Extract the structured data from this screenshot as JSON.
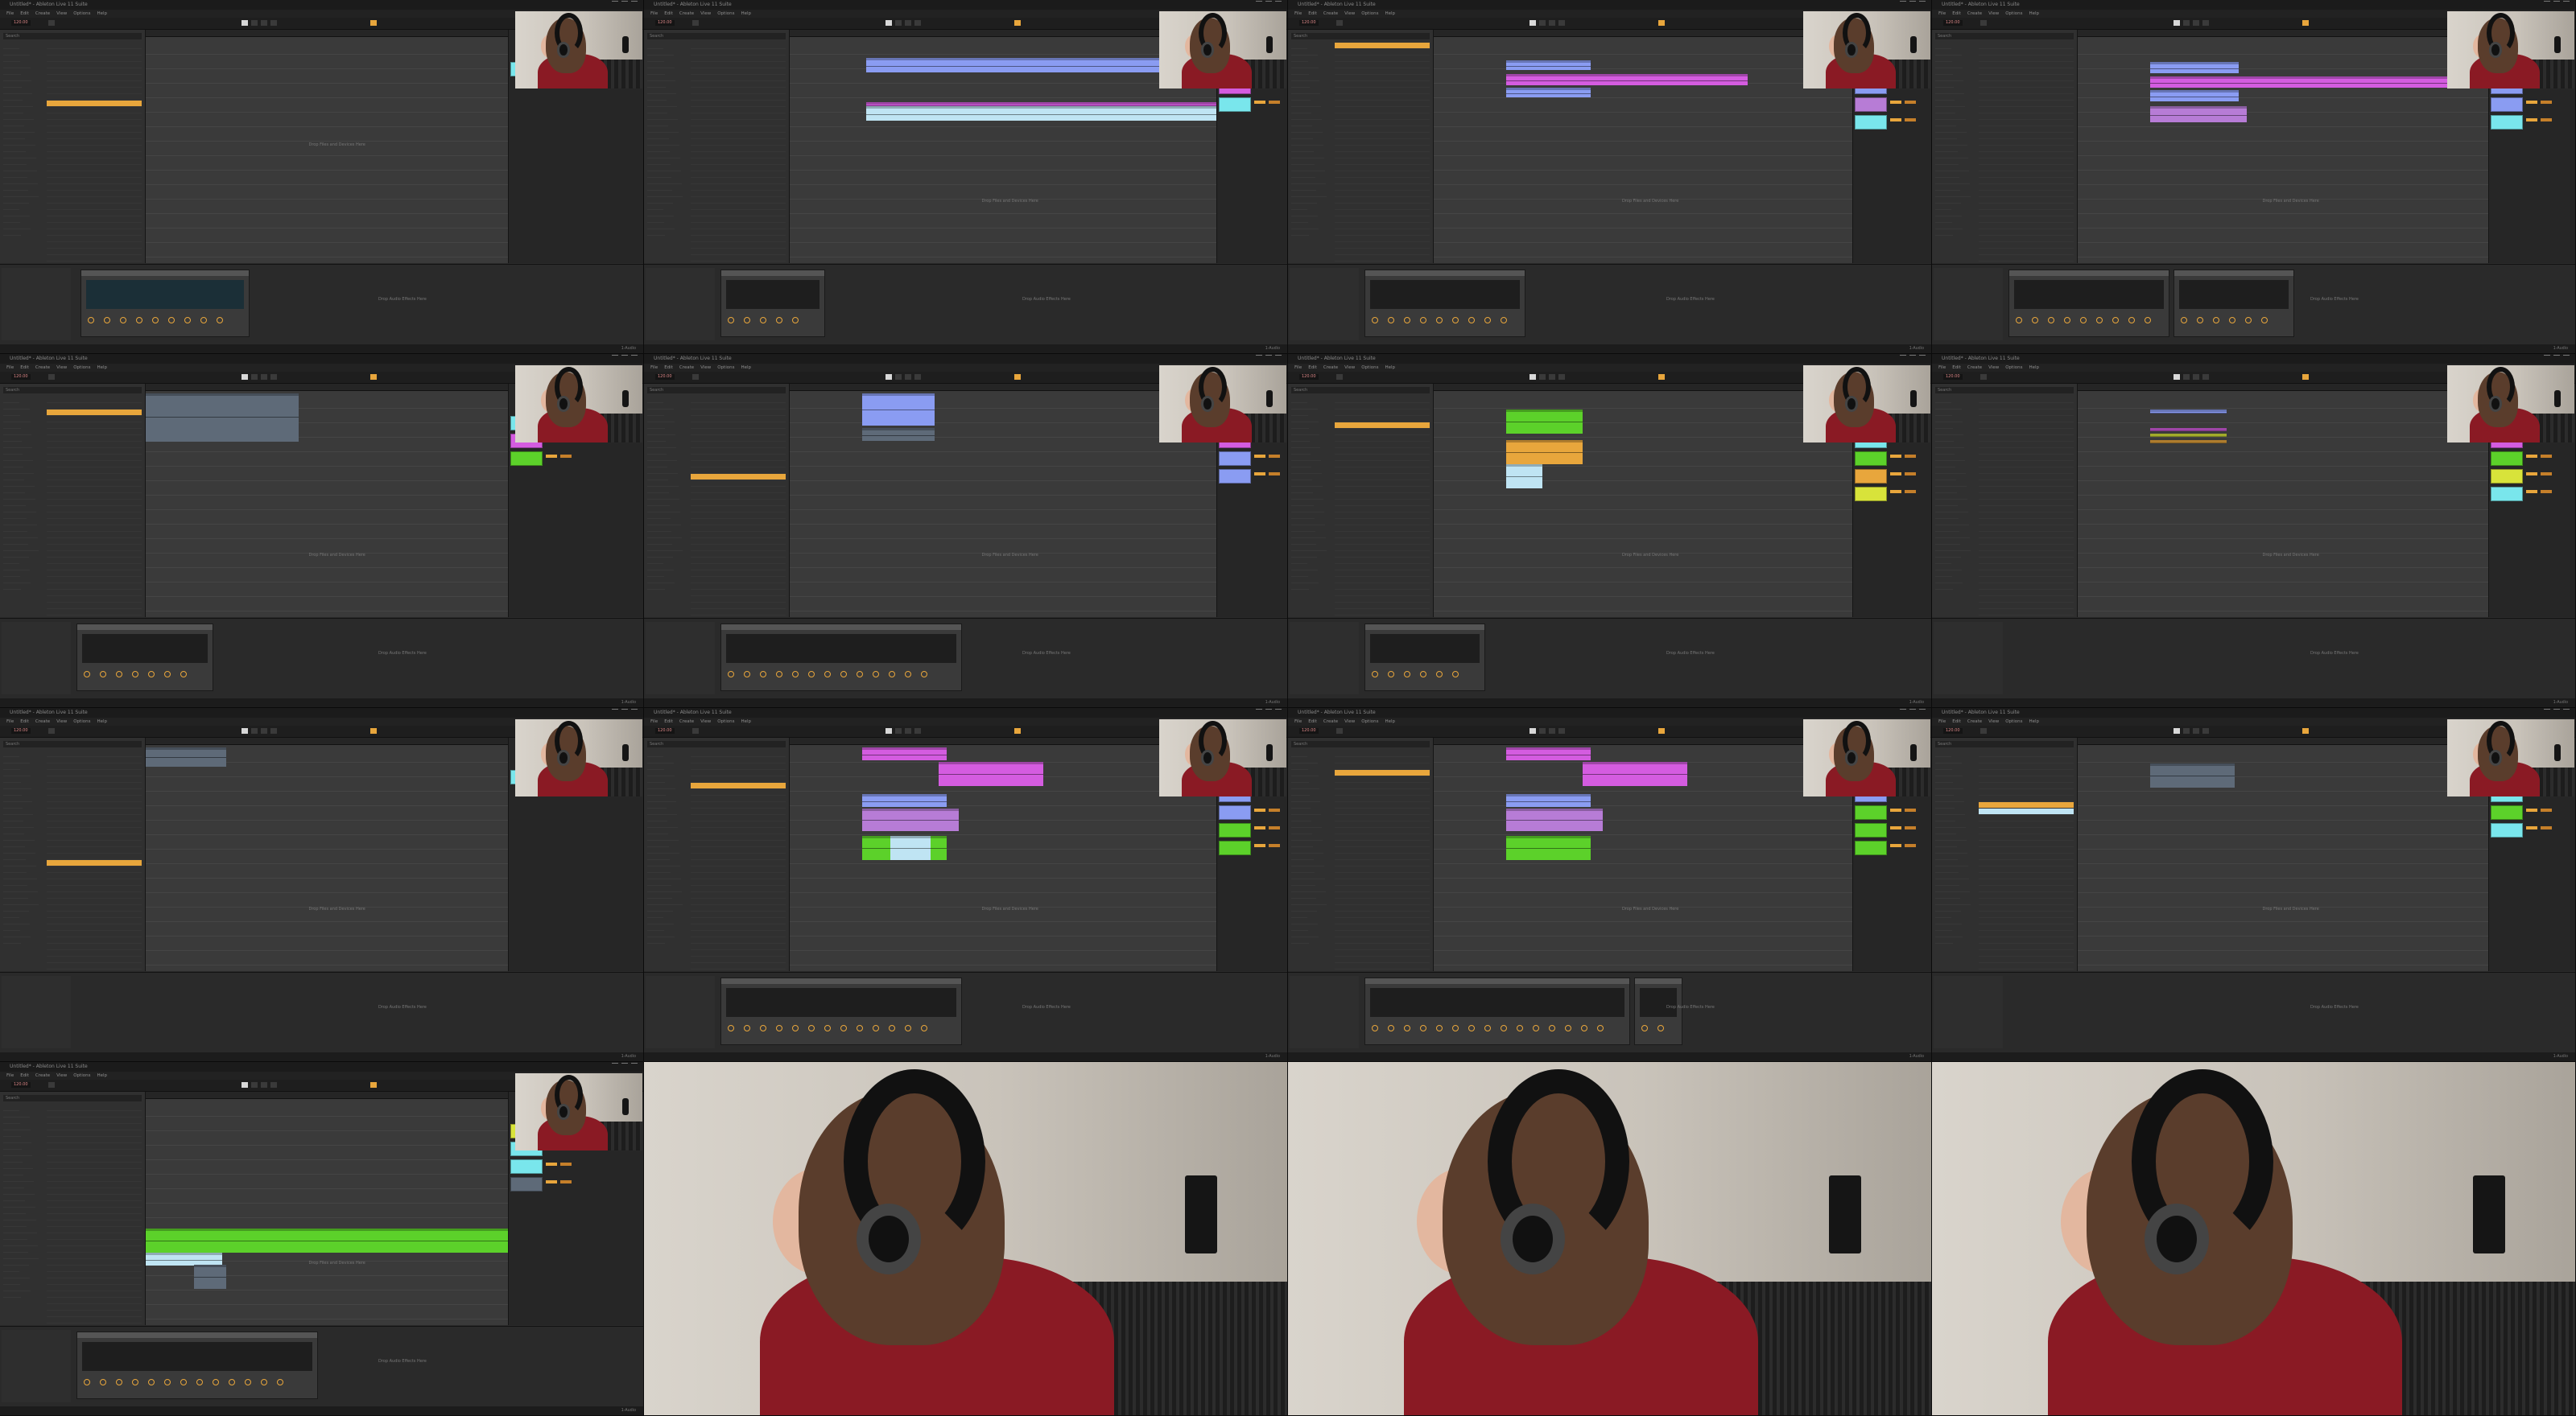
{
  "windows": [
    {
      "title": "Untitled* - Ableton Live 11 Suite",
      "menu": [
        "File",
        "Edit",
        "Create",
        "View",
        "Options",
        "Help"
      ],
      "tempo": "120.00",
      "browser_search": "Search",
      "drop_hint": "Drop Files and Devices Here",
      "device_hint": "Drop Audio Effects Here",
      "status": "1-Audio"
    }
  ],
  "webcam": {
    "icons": [
      "headphones-icon",
      "microphone-icon",
      "office-chair-icon"
    ]
  },
  "colors": {
    "accent_orange": "#e8a63c",
    "clip_blue": "#8a9cf2",
    "clip_lightblue": "#bfe4f3",
    "clip_magenta": "#d45ce0",
    "clip_green": "#5cd12a",
    "clip_cyan": "#79e6ec",
    "clip_yellow": "#d8e33a",
    "clip_purple": "#b77cd6",
    "background": "#2b2b2b"
  }
}
